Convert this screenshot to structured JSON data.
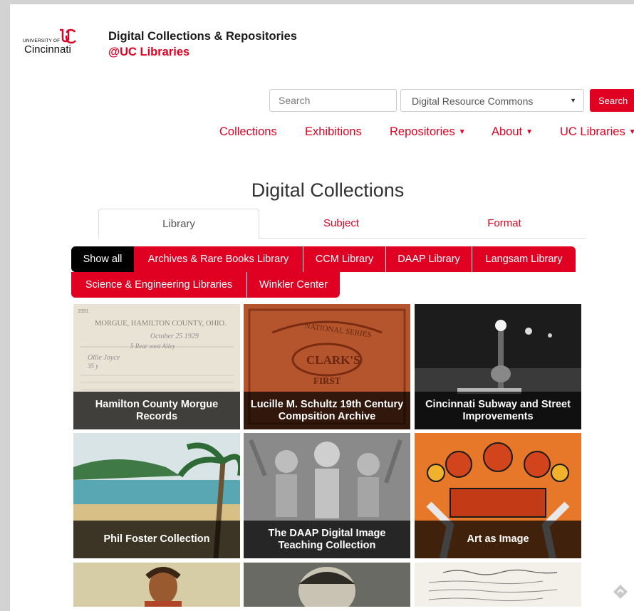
{
  "header": {
    "logo_small": "UNIVERSITY OF",
    "logo_main": "Cincinnati",
    "title": "Digital Collections & Repositories",
    "subtitle": "@UC Libraries"
  },
  "search": {
    "placeholder": "Search",
    "scope": "Digital Resource Commons",
    "button_label": "Search"
  },
  "nav": {
    "items": [
      {
        "label": "Collections",
        "dropdown": false
      },
      {
        "label": "Exhibitions",
        "dropdown": false
      },
      {
        "label": "Repositories",
        "dropdown": true
      },
      {
        "label": "About",
        "dropdown": true
      },
      {
        "label": "UC Libraries",
        "dropdown": true
      }
    ]
  },
  "main": {
    "title": "Digital Collections",
    "tabs": [
      {
        "label": "Library",
        "active": true
      },
      {
        "label": "Subject",
        "active": false
      },
      {
        "label": "Format",
        "active": false
      }
    ],
    "filters": [
      {
        "label": "Show all",
        "active": true
      },
      {
        "label": "Archives & Rare Books Library",
        "active": false
      },
      {
        "label": "CCM Library",
        "active": false
      },
      {
        "label": "DAAP Library",
        "active": false
      },
      {
        "label": "Langsam Library",
        "active": false
      },
      {
        "label": "Science & Engineering Libraries",
        "active": false
      },
      {
        "label": "Winkler Center",
        "active": false
      }
    ],
    "collections": [
      {
        "caption": "Hamilton County Morgue Records",
        "image": "handwritten morgue ledger page"
      },
      {
        "caption": "Lucille M. Schultz 19th Century Compsition Archive",
        "image": "ornate book cover"
      },
      {
        "caption": "Cincinnati Subway and Street Improvements",
        "image": "night street with lamp"
      },
      {
        "caption": "Phil Foster Collection",
        "image": "tropical beach painting"
      },
      {
        "caption": "The DAAP Digital Image Teaching Collection",
        "image": "stone relief sculpture"
      },
      {
        "caption": "Art as Image",
        "image": "decorative floral poster"
      },
      {
        "caption": "",
        "image": "portrait illustration"
      },
      {
        "caption": "",
        "image": "vintage photograph portrait"
      },
      {
        "caption": "",
        "image": "handwritten document"
      }
    ]
  },
  "colors": {
    "brand_red": "#e00122",
    "active_pill": "#000000",
    "page_bg": "#ffffff",
    "outer_bg": "#d3d3d3"
  }
}
